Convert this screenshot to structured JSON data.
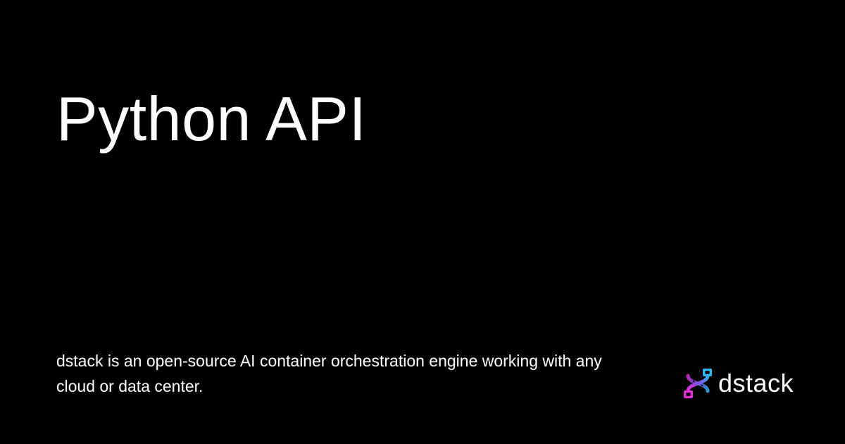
{
  "title": "Python API",
  "description": "dstack is an open-source AI container orchestration engine working with any cloud or data center.",
  "brand": {
    "name": "dstack",
    "logo_icon": "dstack-logo-icon"
  },
  "colors": {
    "background": "#000000",
    "text": "#ffffff",
    "logo_gradient_start": "#e22dd2",
    "logo_gradient_mid": "#8a4ce6",
    "logo_gradient_end": "#2fb6f5"
  }
}
